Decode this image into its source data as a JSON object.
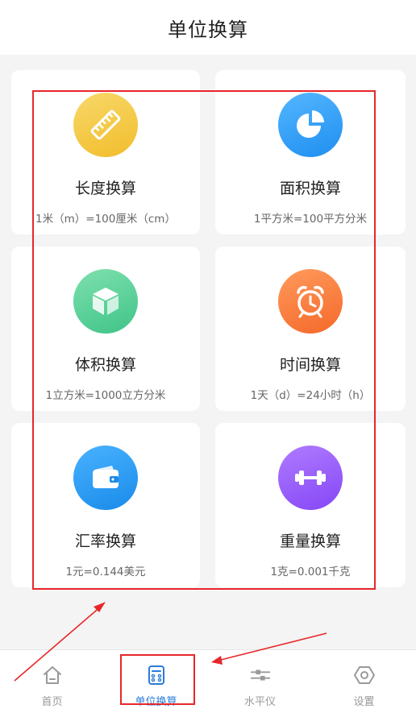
{
  "header": {
    "title": "单位换算"
  },
  "cards": [
    {
      "icon": "ruler-icon",
      "title": "长度换算",
      "subtitle": "1米（m）=100厘米（cm）"
    },
    {
      "icon": "pie-chart-icon",
      "title": "面积换算",
      "subtitle": "1平方米=100平方分米"
    },
    {
      "icon": "cube-icon",
      "title": "体积换算",
      "subtitle": "1立方米=1000立方分米"
    },
    {
      "icon": "alarm-clock-icon",
      "title": "时间换算",
      "subtitle": "1天（d）=24小时（h）"
    },
    {
      "icon": "wallet-icon",
      "title": "汇率换算",
      "subtitle": "1元=0.144美元"
    },
    {
      "icon": "dumbbell-icon",
      "title": "重量换算",
      "subtitle": "1克=0.001千克"
    }
  ],
  "tabs": [
    {
      "icon": "home-icon",
      "label": "首页"
    },
    {
      "icon": "calculator-icon",
      "label": "单位换算",
      "active": true
    },
    {
      "icon": "level-icon",
      "label": "水平仪"
    },
    {
      "icon": "settings-icon",
      "label": "设置"
    }
  ],
  "colors": {
    "accent": "#2a7bd8",
    "annotation": "#e8262a"
  }
}
